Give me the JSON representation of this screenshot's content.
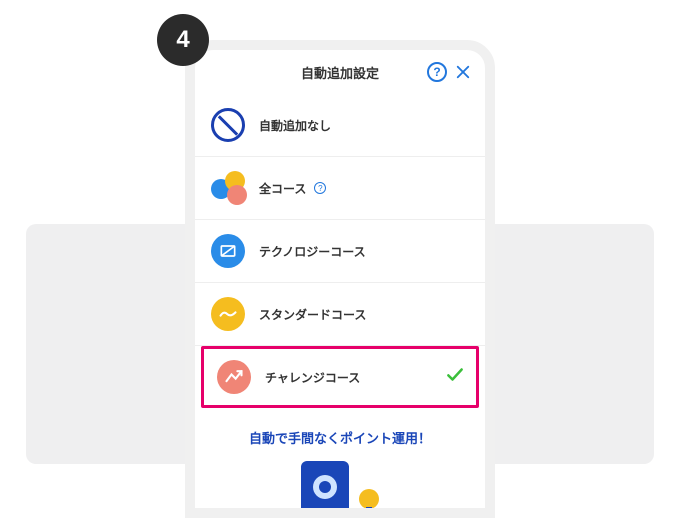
{
  "step": "4",
  "header": {
    "title": "自動追加設定",
    "help_label": "?"
  },
  "options": {
    "none": "自動追加なし",
    "all": "全コース",
    "technology": "テクノロジーコース",
    "standard": "スタンダードコース",
    "challenge": "チャレンジコース"
  },
  "promo": "自動で手間なくポイント運用！",
  "all_badge": "?",
  "colors": {
    "blue": "#2a8ce8",
    "yellow": "#f5bd1f",
    "salmon": "#f08576",
    "navy": "#1a46b8",
    "highlight": "#e6006a",
    "check": "#3bbf3b"
  }
}
